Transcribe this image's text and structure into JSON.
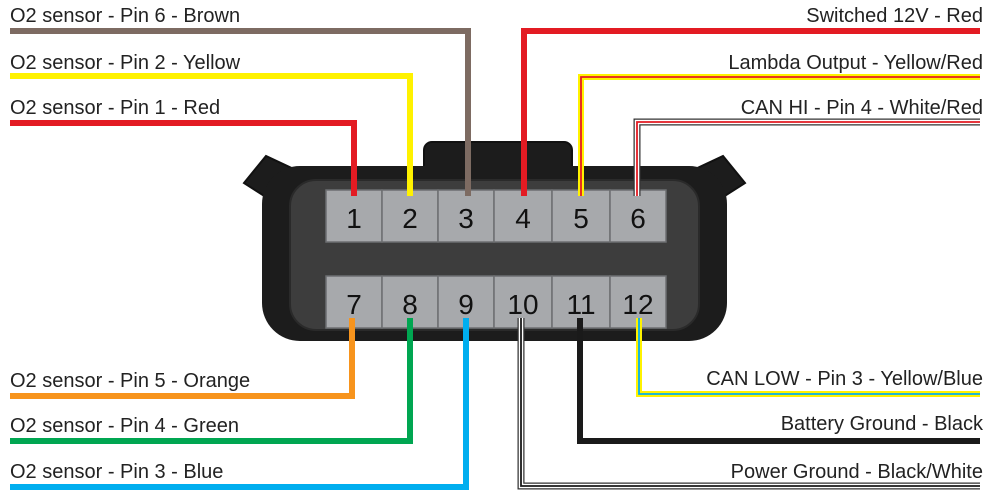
{
  "connector": {
    "pins_top": [
      "1",
      "2",
      "3",
      "4",
      "5",
      "6"
    ],
    "pins_bottom": [
      "7",
      "8",
      "9",
      "10",
      "11",
      "12"
    ]
  },
  "labels": {
    "pin1": "O2 sensor - Pin 1 - Red",
    "pin2": "O2 sensor - Pin 2 - Yellow",
    "pin3": "O2 sensor - Pin 6 - Brown",
    "pin4": "Switched 12V - Red",
    "pin5": "Lambda Output - Yellow/Red",
    "pin6": "CAN HI - Pin 4 - White/Red",
    "pin7": "O2 sensor - Pin 5 - Orange",
    "pin8": "O2 sensor - Pin 4 - Green",
    "pin9": "O2 sensor - Pin 3 - Blue",
    "pin10": "Power Ground - Black/White",
    "pin11": "Battery Ground - Black",
    "pin12": "CAN LOW - Pin 3 - Yellow/Blue"
  },
  "wire_colors": {
    "red": "#e31b23",
    "yellow": "#fff200",
    "brown": "#7d6b62",
    "orange": "#f7941d",
    "green": "#00a651",
    "blue": "#00aeef",
    "black": "#1a1a1a",
    "white": "#ffffff",
    "connector_body": "#3d3d3d",
    "pin_cell": "#a7a9ac"
  }
}
